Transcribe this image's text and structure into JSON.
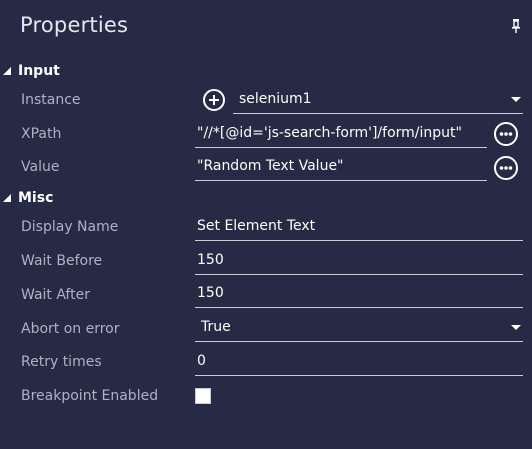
{
  "panel": {
    "title": "Properties"
  },
  "sections": {
    "input": {
      "label": "Input"
    },
    "misc": {
      "label": "Misc"
    }
  },
  "fields": {
    "instance": {
      "label": "Instance",
      "value": "selenium1"
    },
    "xpath": {
      "label": "XPath",
      "value": "\"//*[@id='js-search-form']/form/input\""
    },
    "value": {
      "label": "Value",
      "value": "\"Random Text Value\""
    },
    "display_name": {
      "label": "Display Name",
      "value": "Set Element Text"
    },
    "wait_before": {
      "label": "Wait Before",
      "value": "150"
    },
    "wait_after": {
      "label": "Wait After",
      "value": "150"
    },
    "abort_on_error": {
      "label": "Abort on error",
      "value": "True"
    },
    "retry_times": {
      "label": "Retry times",
      "value": "0"
    },
    "breakpoint_enabled": {
      "label": "Breakpoint Enabled",
      "checked": false
    }
  },
  "icons": {
    "pin": "pin-icon",
    "add": "plus-circle-icon",
    "more": "ellipsis-circle-icon",
    "dropdown": "chevron-down-icon",
    "collapse": "triangle-collapse-icon"
  },
  "colors": {
    "background": "#262a45",
    "label_text": "#aeb2c4",
    "value_text": "#ffffff",
    "underline": "#c9ccd8"
  }
}
